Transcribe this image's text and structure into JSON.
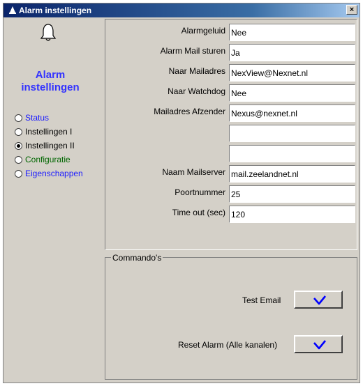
{
  "window": {
    "title": "Alarm instellingen",
    "close_glyph": "×"
  },
  "sidebar": {
    "icon": "bell-icon",
    "title_line1": "Alarm",
    "title_line2": "instellingen",
    "items": [
      {
        "label": "Status",
        "selected": false
      },
      {
        "label": "Instellingen I",
        "selected": false
      },
      {
        "label": "Instellingen II",
        "selected": true
      },
      {
        "label": "Configuratie",
        "selected": false
      },
      {
        "label": "Eigenschappen",
        "selected": false
      }
    ]
  },
  "form": {
    "fields": [
      {
        "label": "Alarmgeluid",
        "value": "Nee"
      },
      {
        "label": "Alarm Mail sturen",
        "value": "Ja"
      },
      {
        "label": "Naar Mailadres",
        "value": "NexView@Nexnet.nl"
      },
      {
        "label": "Naar Watchdog",
        "value": "Nee"
      },
      {
        "label": "Mailadres Afzender",
        "value": "Nexus@nexnet.nl"
      },
      {
        "label": "",
        "value": ""
      },
      {
        "label": "",
        "value": ""
      },
      {
        "label": "Naam Mailserver",
        "value": "mail.zeelandnet.nl"
      },
      {
        "label": "Poortnummer",
        "value": "25"
      },
      {
        "label": "Time out (sec)",
        "value": "120"
      }
    ]
  },
  "commands": {
    "legend": "Commando's",
    "test_email_label": "Test Email",
    "reset_alarm_label": "Reset Alarm (Alle kanalen)",
    "button_icon": "checkmark-icon"
  },
  "colors": {
    "titlebar": "#0a246a",
    "sidebar_title": "#3333ff",
    "link_blue": "#1a1aff",
    "link_green": "#006600",
    "check": "#0000ff"
  }
}
